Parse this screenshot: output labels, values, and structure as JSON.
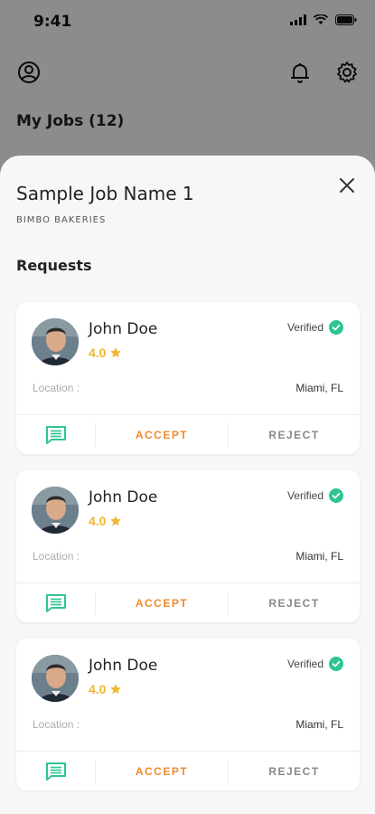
{
  "status_bar": {
    "time": "9:41"
  },
  "background": {
    "my_jobs_label": "My Jobs (12)"
  },
  "sheet": {
    "title": "Sample Job Name 1",
    "company": "BIMBO BAKERIES",
    "section_title": "Requests"
  },
  "requests": [
    {
      "name": "John Doe",
      "rating": "4.0",
      "verified_label": "Verified",
      "location_label": "Location :",
      "location": "Miami, FL",
      "accept_label": "ACCEPT",
      "reject_label": "REJECT"
    },
    {
      "name": "John Doe",
      "rating": "4.0",
      "verified_label": "Verified",
      "location_label": "Location :",
      "location": "Miami, FL",
      "accept_label": "ACCEPT",
      "reject_label": "REJECT"
    },
    {
      "name": "John Doe",
      "rating": "4.0",
      "verified_label": "Verified",
      "location_label": "Location :",
      "location": "Miami, FL",
      "accept_label": "ACCEPT",
      "reject_label": "REJECT"
    }
  ],
  "colors": {
    "accent_accept": "#f08a2c",
    "star": "#f2b72a",
    "verified": "#2ec591",
    "chat_icon": "#2ec591"
  },
  "icons": [
    "profile-icon",
    "bell-icon",
    "gear-icon",
    "close-icon",
    "star-icon",
    "verified-check-icon",
    "chat-icon"
  ]
}
